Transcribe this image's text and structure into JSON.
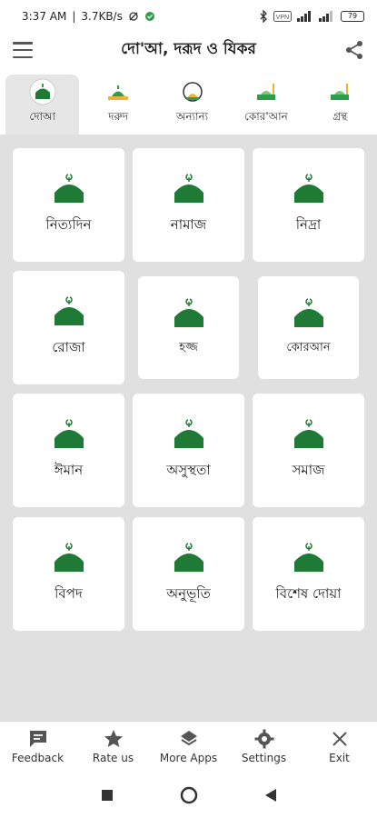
{
  "status": {
    "time": "3:37 AM",
    "speed": "3.7KB/s",
    "battery": "79"
  },
  "app": {
    "title": "দো'আ, দরূদ ও যিকর"
  },
  "tabs": [
    {
      "label": "দোআ",
      "active": true
    },
    {
      "label": "দরুদ",
      "active": false
    },
    {
      "label": "অন্যান্য",
      "active": false
    },
    {
      "label": "কোর'আন",
      "active": false
    },
    {
      "label": "গ্রন্থ",
      "active": false
    }
  ],
  "categories": [
    {
      "label": "নিত্যদিন"
    },
    {
      "label": "নামাজ"
    },
    {
      "label": "নিদ্রা"
    },
    {
      "label": "রোজা"
    },
    {
      "label": "হজ্জ"
    },
    {
      "label": "কোরআন"
    },
    {
      "label": "ঈমান"
    },
    {
      "label": "অসুস্থতা"
    },
    {
      "label": "সমাজ"
    },
    {
      "label": "বিপদ"
    },
    {
      "label": "অনুভূতি"
    },
    {
      "label": "বিশেষ দোয়া"
    }
  ],
  "bottom_bar": {
    "feedback": "Feedback",
    "rate": "Rate us",
    "more_apps": "More Apps",
    "settings": "Settings",
    "exit": "Exit"
  },
  "colors": {
    "accent_green": "#1e7a34",
    "grid_bg": "#e0e0e0"
  }
}
